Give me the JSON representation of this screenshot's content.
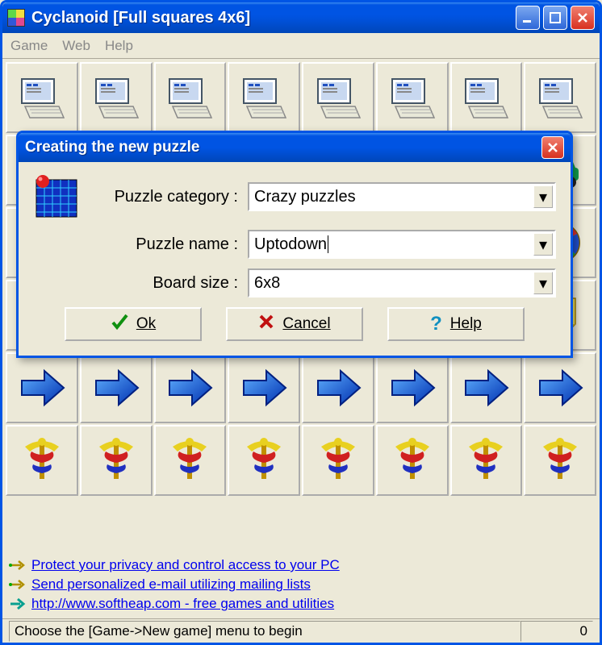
{
  "window": {
    "title": "Cyclanoid [Full squares 4x6]",
    "icon_colors": [
      "#5ed848",
      "#f0e040",
      "#3058d8",
      "#e04890"
    ]
  },
  "menu": {
    "game": "Game",
    "web": "Web",
    "help": "Help"
  },
  "dialog": {
    "title": "Creating the new puzzle",
    "labels": {
      "category": "Puzzle category :",
      "name": "Puzzle name :",
      "size": "Board size :"
    },
    "values": {
      "category": "Crazy puzzles",
      "name": "Uptodown",
      "size": "6x8"
    },
    "buttons": {
      "ok": "Ok",
      "cancel": "Cancel",
      "help": "Help"
    }
  },
  "links": {
    "l1": "Protect your privacy and control access to your PC",
    "l2": "Send personalized e-mail utilizing mailing lists",
    "l3": "http://www.softheap.com - free games and utilities"
  },
  "status": {
    "left": "Choose the [Game->New game] menu to begin",
    "right": "0"
  }
}
